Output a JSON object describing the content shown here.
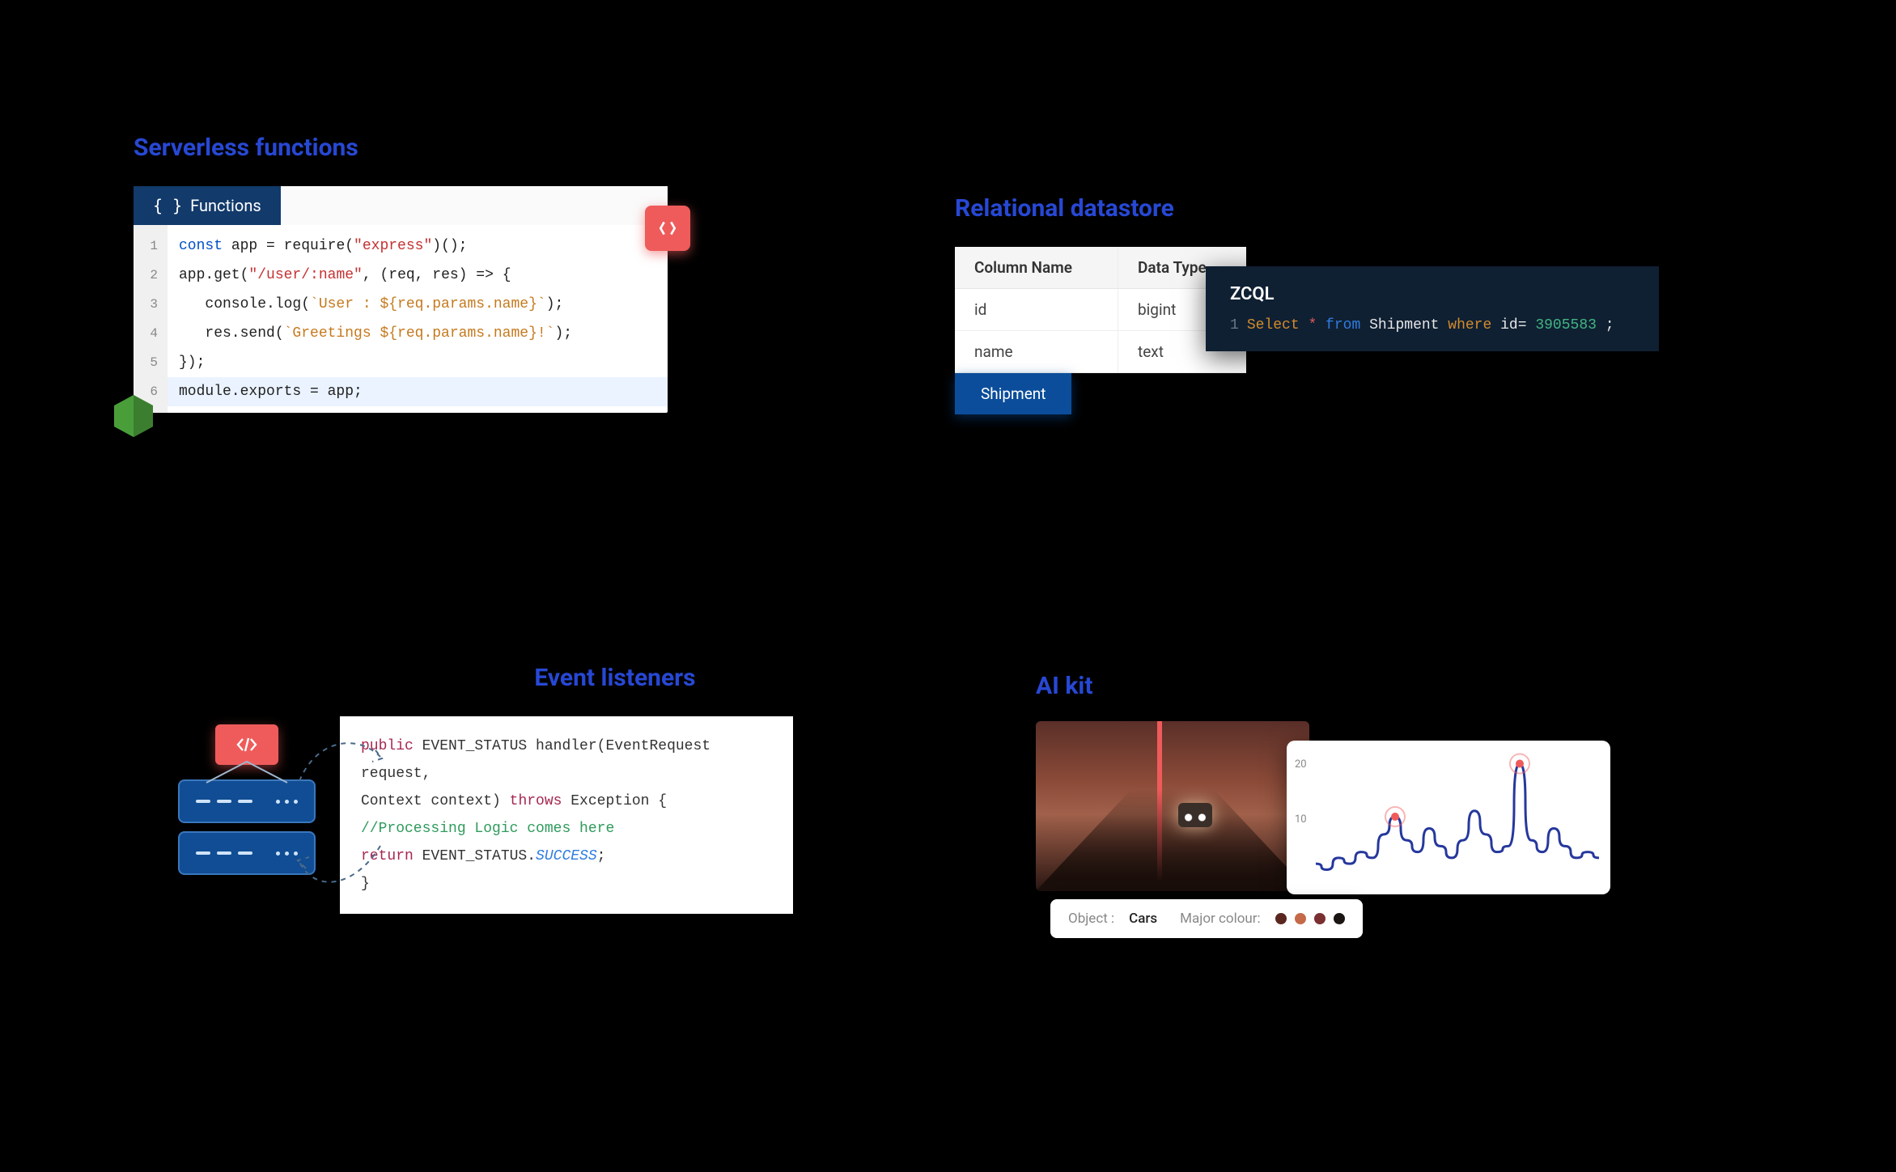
{
  "serverless": {
    "title": "Serverless functions",
    "tab_label": "Functions",
    "code_lines": [
      {
        "n": "1",
        "tokens": [
          [
            "kw-blue",
            "const"
          ],
          [
            "code-black",
            " app = require("
          ],
          [
            "kw-red",
            "\"express\""
          ],
          [
            "code-black",
            ")();"
          ]
        ]
      },
      {
        "n": "2",
        "tokens": [
          [
            "code-black",
            "app.get("
          ],
          [
            "kw-red",
            "\"/user/:name\""
          ],
          [
            "code-black",
            ", (req, res) => {"
          ]
        ]
      },
      {
        "n": "3",
        "tokens": [
          [
            "code-black",
            "   console.log("
          ],
          [
            "kw-orange",
            "`User : ${req.params.name}`"
          ],
          [
            "code-black",
            ");"
          ]
        ]
      },
      {
        "n": "4",
        "tokens": [
          [
            "code-black",
            "   res.send("
          ],
          [
            "kw-orange",
            "`Greetings ${req.params.name}!`"
          ],
          [
            "code-black",
            ");"
          ]
        ]
      },
      {
        "n": "5",
        "tokens": [
          [
            "code-black",
            "});"
          ]
        ]
      },
      {
        "n": "6",
        "hl": true,
        "tokens": [
          [
            "code-black",
            "module.exports = app;"
          ]
        ]
      }
    ]
  },
  "relational": {
    "title": "Relational datastore",
    "columns": [
      "Column Name",
      "Data Type"
    ],
    "rows": [
      [
        "id",
        "bigint"
      ],
      [
        "name",
        "text"
      ]
    ],
    "shipment_label": "Shipment",
    "zcql_title": "ZCQL",
    "zcql_line_no": "1",
    "zcql_tokens": [
      [
        "sel",
        "Select "
      ],
      [
        "star",
        "*"
      ],
      [
        "frm",
        " from "
      ],
      [
        "tbl",
        "Shipment "
      ],
      [
        "whr",
        "where "
      ],
      [
        "eq",
        "id= "
      ],
      [
        "num",
        "3905583"
      ],
      [
        "eq",
        " ;"
      ]
    ]
  },
  "events": {
    "title": "Event listeners",
    "code_lines": [
      [
        [
          "pub",
          "public"
        ],
        [
          "cls",
          " EVENT_STATUS handler(EventRequest request,"
        ]
      ],
      [
        [
          "cls",
          "Context context) "
        ],
        [
          "thr",
          "throws"
        ],
        [
          "cls",
          " Exception {"
        ]
      ],
      [
        [
          "cls",
          "    "
        ],
        [
          "cmt",
          "//Processing Logic comes here"
        ]
      ],
      [
        [
          "cls",
          "    "
        ],
        [
          "ret",
          "return"
        ],
        [
          "cls",
          " EVENT_STATUS."
        ],
        [
          "suc",
          "SUCCESS"
        ],
        [
          "cls",
          ";"
        ]
      ],
      [
        [
          "cls",
          "}"
        ]
      ]
    ]
  },
  "aikit": {
    "title": "AI kit",
    "y_ticks": [
      "20",
      "10"
    ],
    "object_label": "Object :",
    "object_value": "Cars",
    "colour_label": "Major colour:",
    "swatches": [
      "#5a2620",
      "#c56a48",
      "#7a2f30",
      "#1a1412"
    ]
  },
  "chart_data": {
    "type": "line",
    "title": "",
    "xlabel": "",
    "ylabel": "",
    "ylim": [
      0,
      22
    ],
    "x": [
      0,
      1,
      2,
      3,
      4,
      5,
      6,
      7,
      8,
      9,
      10,
      11,
      12,
      13,
      14,
      15,
      16,
      17,
      18,
      19,
      20,
      21,
      22,
      23,
      24,
      25
    ],
    "values": [
      3,
      2,
      4,
      3,
      5,
      4,
      8,
      11,
      7,
      5,
      9,
      6,
      4,
      7,
      12,
      8,
      5,
      6,
      20,
      7,
      5,
      9,
      6,
      4,
      5,
      4
    ],
    "peaks_x": [
      7,
      18
    ]
  }
}
